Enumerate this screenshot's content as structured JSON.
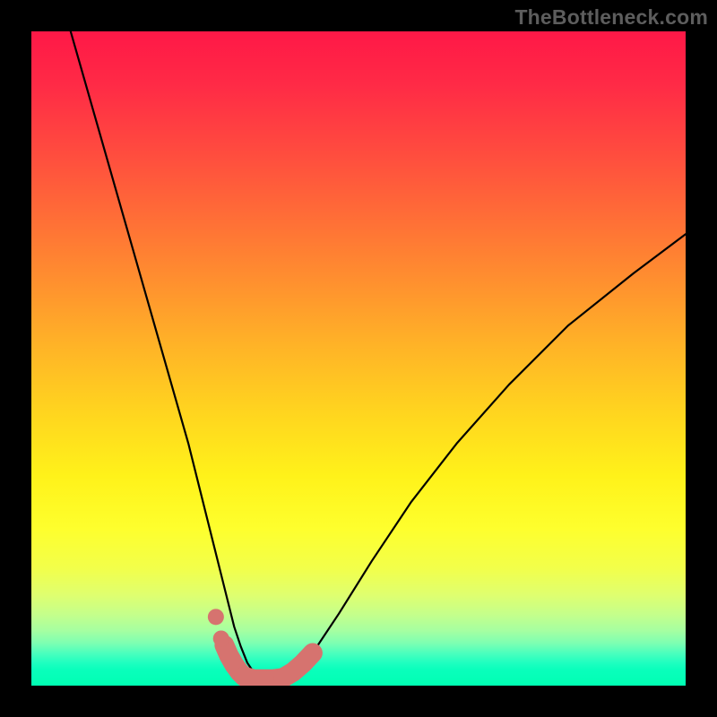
{
  "watermark": "TheBottleneck.com",
  "chart_data": {
    "type": "line",
    "title": "",
    "xlabel": "",
    "ylabel": "",
    "xlim": [
      0,
      100
    ],
    "ylim": [
      0,
      100
    ],
    "series": [
      {
        "name": "bottleneck-curve",
        "x": [
          6,
          8,
          10,
          12,
          14,
          16,
          18,
          20,
          22,
          24,
          26,
          27,
          28,
          29,
          30,
          31,
          32,
          33,
          34,
          35,
          36,
          37,
          38,
          40,
          43,
          47,
          52,
          58,
          65,
          73,
          82,
          92,
          100
        ],
        "y": [
          100,
          93,
          86,
          79,
          72,
          65,
          58,
          51,
          44,
          37,
          29,
          25,
          21,
          17,
          13,
          9,
          6,
          3.5,
          2,
          1.3,
          1,
          1,
          1.2,
          2,
          5,
          11,
          19,
          28,
          37,
          46,
          55,
          63,
          69
        ]
      }
    ],
    "markers": [
      {
        "name": "dot-1",
        "x": 28.2,
        "y": 10.5
      },
      {
        "name": "dot-2",
        "x": 29.0,
        "y": 7.2
      }
    ],
    "thick_segments": [
      {
        "name": "thick-left",
        "x": [
          29.5,
          30.2,
          31.0,
          31.8,
          32.5
        ],
        "y": [
          6.2,
          4.6,
          3.2,
          2.1,
          1.4
        ]
      },
      {
        "name": "thick-floor",
        "x": [
          32.5,
          34.0,
          35.5,
          37.0,
          38.5
        ],
        "y": [
          1.4,
          1.0,
          1.0,
          1.0,
          1.2
        ]
      },
      {
        "name": "thick-right",
        "x": [
          38.5,
          40.0,
          41.5,
          43.0
        ],
        "y": [
          1.2,
          2.1,
          3.4,
          5.0
        ]
      }
    ],
    "colors": {
      "curve": "#000000",
      "marker": "#d6736f",
      "thick": "#d6736f"
    }
  }
}
